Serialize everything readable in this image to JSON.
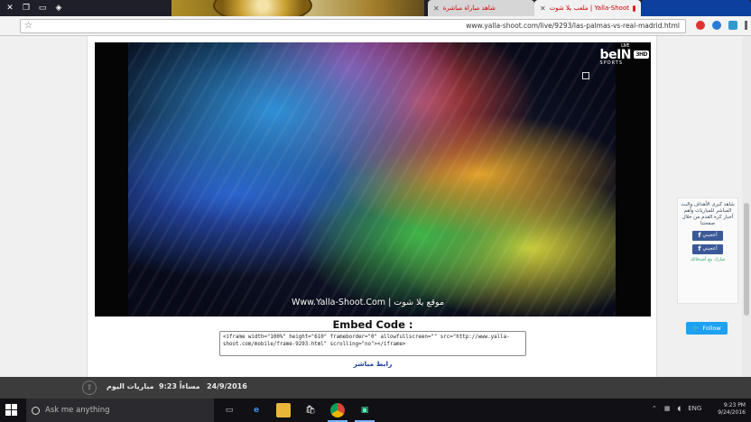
{
  "browser": {
    "tabs": [
      {
        "label": "ملعب يلا شوت | Yalla-Shoot",
        "active": true
      },
      {
        "label": "شاهد مباراة مباشرة",
        "active": false
      },
      {
        "label": "",
        "active": false
      }
    ],
    "url": "www.yalla-shoot.com/live/9293/las-palmas-vs-real-madrid.html"
  },
  "video": {
    "channel_logo": "beIN",
    "channel_sub": "SPORTS",
    "channel_live": "LIVE",
    "channel_hd": "3HD",
    "watermark": "Www.Yalla-Shoot.Com | موقع يلا شوت"
  },
  "embed": {
    "title": "Embed Code :",
    "code": "<iframe width=\"100%\" height=\"610\" frameborder=\"0\" allowfullscreen=\"\" src=\"http://www.yalla-shoot.com/mobile/frame-9293.html\" scrolling=\"no\"></iframe>",
    "live_link": "رابط مباشر"
  },
  "side_widget": {
    "blurb": "شاهد كبرى الأهداف والبث المباشر للمباريات وأهم أخبار كرة القدم من خلال صفحتنا",
    "fb_button_1": "أعجبني",
    "fb_button_2": "أعجبني",
    "small_text": "شارك مع أصدقائك",
    "twitter_button": "Follow"
  },
  "bottom_bar": {
    "date": "24/9/2016",
    "time": "9:23 مساءاً",
    "matches_today": "مباريات اليوم"
  },
  "taskbar": {
    "search_placeholder": "Ask me anything",
    "language": "ENG",
    "clock_time": "9:23 PM",
    "clock_date": "9/24/2016"
  }
}
